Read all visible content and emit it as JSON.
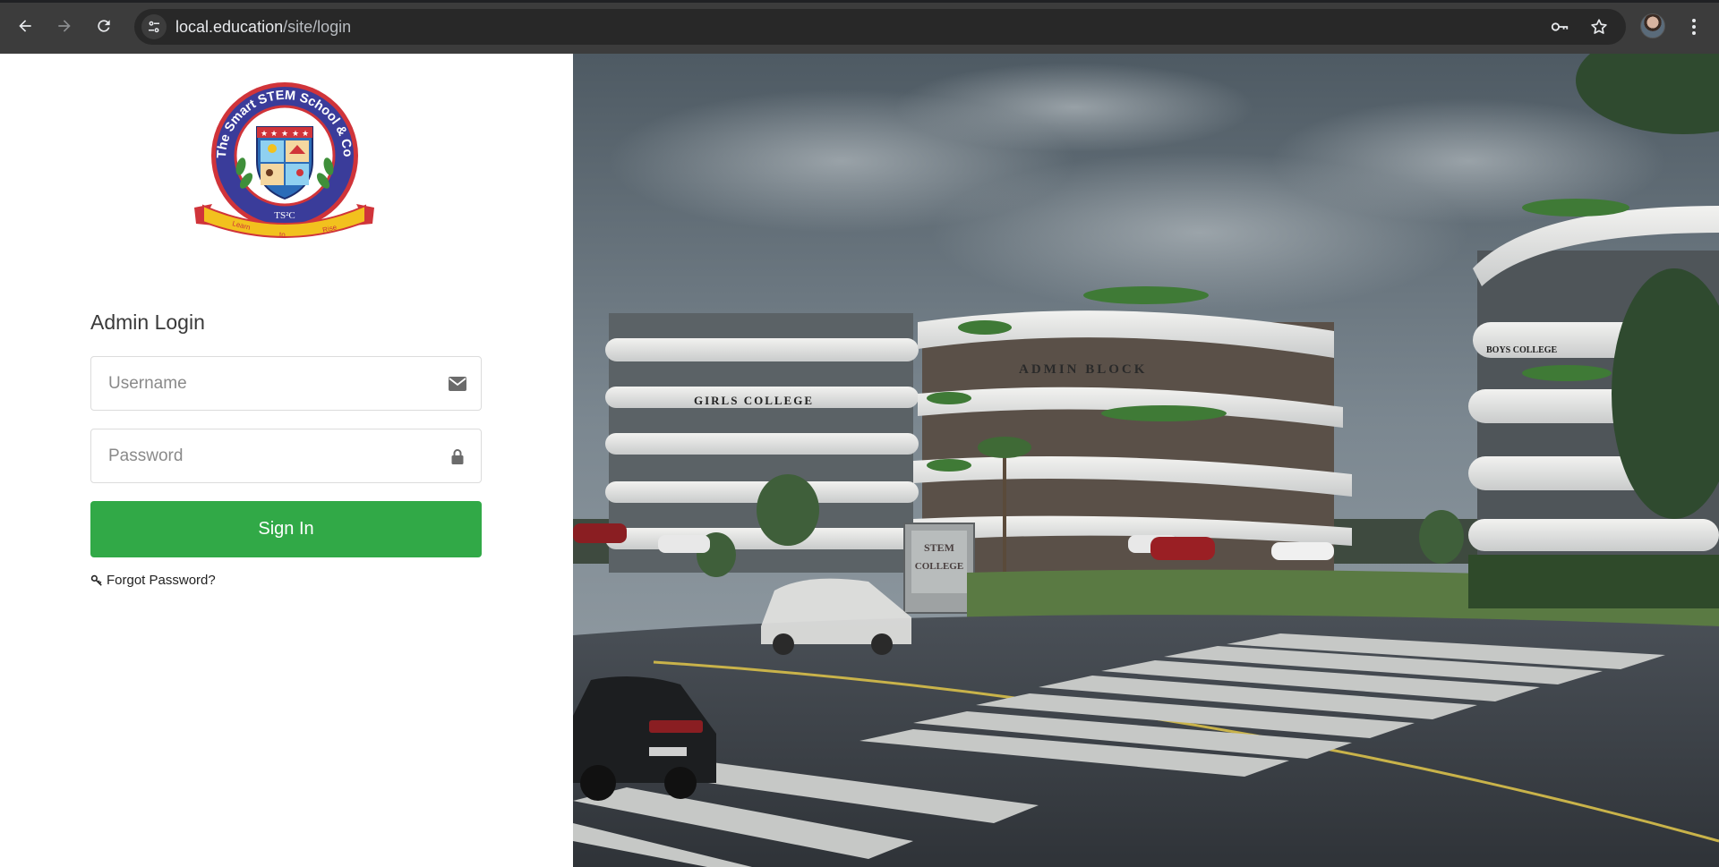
{
  "browser": {
    "url_host": "local.education",
    "url_path": "/site/login"
  },
  "icons": {
    "back": "arrow-left-icon",
    "forward": "arrow-right-icon",
    "reload": "reload-icon",
    "site_info": "tune-icon",
    "password_manager": "key-icon",
    "bookmark": "star-icon",
    "menu": "kebab-menu-icon",
    "username": "envelope-icon",
    "password": "lock-icon",
    "forgot": "key-icon"
  },
  "logo": {
    "ring_text": "The Smart STEM School & College",
    "initials": "TS²C",
    "ribbon_words": [
      "Learn",
      "to",
      "Rise"
    ]
  },
  "login": {
    "title": "Admin Login",
    "username_placeholder": "Username",
    "password_placeholder": "Password",
    "signin_label": "Sign In",
    "forgot_label": "Forgot Password?"
  },
  "campus": {
    "signs": {
      "girls_college": "GIRLS COLLEGE",
      "admin_block": "ADMIN BLOCK",
      "boys_college": "BOYS COLLEGE",
      "stem_gate": [
        "STEM",
        "COLLEGE"
      ]
    }
  },
  "colors": {
    "signin_green": "#31a947",
    "logo_blue": "#3a3c9a",
    "logo_red": "#d0343a",
    "ribbon_yellow": "#f2c11e"
  }
}
